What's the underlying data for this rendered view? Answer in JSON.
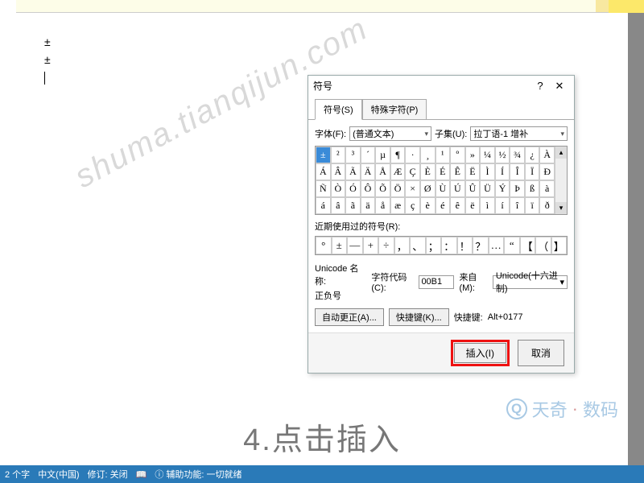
{
  "document": {
    "line1": "±",
    "line2": "±"
  },
  "dialog": {
    "title": "符号",
    "tabs": {
      "symbols": "符号(S)",
      "special": "特殊字符(P)"
    },
    "font_label": "字体(F):",
    "font_value": "(普通文本)",
    "subset_label": "子集(U):",
    "subset_value": "拉丁语-1 增补",
    "grid": [
      [
        "±",
        "²",
        "³",
        "´",
        "µ",
        "¶",
        "·",
        "¸",
        "¹",
        "º",
        "»",
        "¼",
        "½",
        "¾",
        "¿",
        "À"
      ],
      [
        "Á",
        "Â",
        "Ã",
        "Ä",
        "Å",
        "Æ",
        "Ç",
        "È",
        "É",
        "Ê",
        "Ë",
        "Ì",
        "Í",
        "Î",
        "Ï",
        "Ð"
      ],
      [
        "Ñ",
        "Ò",
        "Ó",
        "Ô",
        "Õ",
        "Ö",
        "×",
        "Ø",
        "Ù",
        "Ú",
        "Û",
        "Ü",
        "Ý",
        "Þ",
        "ß",
        "à"
      ],
      [
        "á",
        "â",
        "ã",
        "ä",
        "å",
        "æ",
        "ç",
        "è",
        "é",
        "ê",
        "ë",
        "ì",
        "í",
        "î",
        "ï",
        "ð"
      ]
    ],
    "selected": [
      0,
      0
    ],
    "recent_label": "近期使用过的符号(R):",
    "recent": [
      "°",
      "±",
      "—",
      "+",
      "÷",
      "，",
      "、",
      "；",
      "：",
      "！",
      "？",
      "…",
      "“",
      "【",
      "（",
      "】"
    ],
    "unicode_name_label": "Unicode 名称:",
    "unicode_name": "正负号",
    "char_code_label": "字符代码(C):",
    "char_code": "00B1",
    "from_label": "来自(M):",
    "from_value": "Unicode(十六进制)",
    "autocorrect_btn": "自动更正(A)...",
    "shortcut_btn": "快捷键(K)...",
    "shortcut_label": "快捷键:",
    "shortcut_value": "Alt+0177",
    "insert_btn": "插入(I)",
    "cancel_btn": "取消"
  },
  "status": {
    "words": "2 个字",
    "lang": "中文(中国)",
    "revise": "修订: 关闭",
    "assist_prefix": "辅助功能:",
    "assist_value": "一切就绪"
  },
  "watermark": "shuma.tianqijun.com",
  "caption": "4.点击插入",
  "brand": {
    "icon": "Q",
    "t1": "天奇",
    "dot": "·",
    "t2": "数码"
  }
}
